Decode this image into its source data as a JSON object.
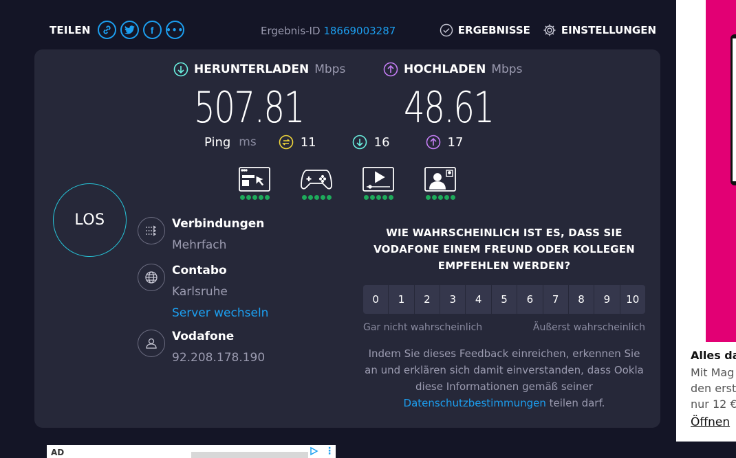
{
  "header": {
    "share_label": "TEILEN",
    "result_label": "Ergebnis-ID",
    "result_id": "18669003287",
    "results_label": "ERGEBNISSE",
    "settings_label": "EINSTELLUNGEN"
  },
  "download": {
    "label": "HERUNTERLADEN",
    "unit": "Mbps",
    "value": "507.81",
    "color": "#6af0e0"
  },
  "upload": {
    "label": "HOCHLADEN",
    "unit": "Mbps",
    "value": "48.61",
    "color": "#c57ef5"
  },
  "ping": {
    "label": "Ping",
    "unit": "ms",
    "idle": "11",
    "download": "16",
    "upload": "17",
    "idle_color": "#f3d83a"
  },
  "use_cases": [
    {
      "icon": "browsing-icon",
      "rating": 5
    },
    {
      "icon": "gaming-icon",
      "rating": 5
    },
    {
      "icon": "video-streaming-icon",
      "rating": 5
    },
    {
      "icon": "video-chat-icon",
      "rating": 5
    }
  ],
  "go_button": "LOS",
  "connection": {
    "title": "Verbindungen",
    "value": "Mehrfach"
  },
  "server": {
    "title": "Contabo",
    "location": "Karlsruhe",
    "change_link": "Server wechseln"
  },
  "isp": {
    "title": "Vodafone",
    "ip": "92.208.178.190"
  },
  "survey": {
    "question": "WIE WAHRSCHEINLICH IST ES, DASS SIE VODAFONE EINEM FREUND ODER KOLLEGEN EMPFEHLEN WERDEN?",
    "scale": [
      "0",
      "1",
      "2",
      "3",
      "4",
      "5",
      "6",
      "7",
      "8",
      "9",
      "10"
    ],
    "low_label": "Gar nicht wahrscheinlich",
    "high_label": "Äußerst wahrscheinlich",
    "disclaimer_text": "Indem Sie dieses Feedback einreichen, erkennen Sie an und erklären sich damit einverstanden, dass Ookla diese Informationen gemäß seiner",
    "disclaimer_link": "Datenschutzbestimmungen",
    "disclaimer_end": "teilen darf."
  },
  "ad_bottom": {
    "label": "AD"
  },
  "side_ad": {
    "headline": "Alles da",
    "body_lines": [
      "Mit Mag",
      "den erst",
      "nur 12 €"
    ],
    "cta": "Öffnen",
    "brand_color": "#e20074"
  },
  "colors": {
    "accent": "#1c9ff0",
    "background": "#141526",
    "panel": "#262839",
    "go_ring": "#26c6da",
    "rating_dot": "#1eaa5b"
  }
}
